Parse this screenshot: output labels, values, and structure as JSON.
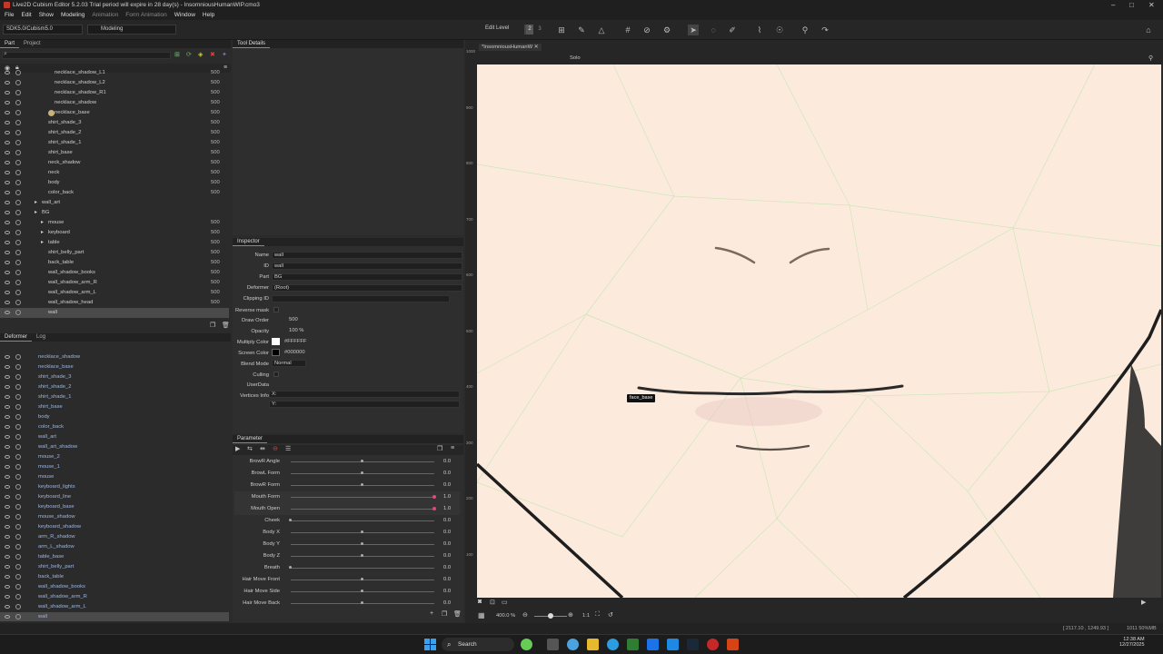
{
  "window": {
    "title": "Live2D Cubism Editor 5.2.03   Trial period will expire in 28 day(s)  - InsomniousHumanWIP.cmo3"
  },
  "menu": [
    "File",
    "Edit",
    "Show",
    "Modeling",
    "Animation",
    "Form Animation",
    "Window",
    "Help"
  ],
  "toolbar": {
    "sdk": "SDK5.0/Cubism5.0",
    "mode": "Modeling",
    "edit_level": "Edit Level",
    "levels": [
      "1",
      "2",
      "3"
    ]
  },
  "part_panel": {
    "tabs": [
      "Part",
      "Project"
    ],
    "items": [
      {
        "name": "necklace_shadow_L1",
        "num": "500",
        "indent": 60
      },
      {
        "name": "necklace_shadow_L2",
        "num": "500",
        "indent": 60
      },
      {
        "name": "necklace_shadow_R1",
        "num": "500",
        "indent": 60
      },
      {
        "name": "necklace_shadow",
        "num": "500",
        "indent": 60
      },
      {
        "name": "necklace_base",
        "num": "500",
        "indent": 60,
        "thumb": true
      },
      {
        "name": "shirt_shade_3",
        "num": "500",
        "indent": 53
      },
      {
        "name": "shirt_shade_2",
        "num": "500",
        "indent": 53
      },
      {
        "name": "shirt_shade_1",
        "num": "500",
        "indent": 53
      },
      {
        "name": "shirt_base",
        "num": "500",
        "indent": 53
      },
      {
        "name": "neck_shadow",
        "num": "500",
        "indent": 53
      },
      {
        "name": "neck",
        "num": "500",
        "indent": 53
      },
      {
        "name": "body",
        "num": "500",
        "indent": 53
      },
      {
        "name": "color_back",
        "num": "500",
        "indent": 53
      },
      {
        "name": "wall_art",
        "num": "",
        "indent": 46,
        "folder": true
      },
      {
        "name": "BG",
        "num": "",
        "indent": 46,
        "folder": true
      },
      {
        "name": "mouse",
        "num": "500",
        "indent": 53,
        "folder": true
      },
      {
        "name": "keyboard",
        "num": "500",
        "indent": 53,
        "folder": true
      },
      {
        "name": "table",
        "num": "500",
        "indent": 53,
        "folder": true
      },
      {
        "name": "shirt_belly_part",
        "num": "500",
        "indent": 53
      },
      {
        "name": "back_table",
        "num": "500",
        "indent": 53
      },
      {
        "name": "wall_shadow_books",
        "num": "500",
        "indent": 53
      },
      {
        "name": "wall_shadow_arm_R",
        "num": "500",
        "indent": 53
      },
      {
        "name": "wall_shadow_arm_L",
        "num": "500",
        "indent": 53
      },
      {
        "name": "wall_shadow_head",
        "num": "500",
        "indent": 53
      },
      {
        "name": "wall",
        "num": "",
        "indent": 53,
        "selected": true
      }
    ]
  },
  "deformer_panel": {
    "tabs": [
      "Deformer",
      "Log"
    ],
    "items": [
      "necklace_shadow",
      "necklace_base",
      "shirt_shade_3",
      "shirt_shade_2",
      "shirt_shade_1",
      "shirt_base",
      "body",
      "color_back",
      "wall_art",
      "wall_art_shadow",
      "mouse_2",
      "mouse_1",
      "mouse",
      "keyboard_lights",
      "keyboard_line",
      "keyboard_base",
      "mouse_shadow",
      "keyboard_shadow",
      "arm_R_shadow",
      "arm_L_shadow",
      "table_base",
      "shirt_belly_part",
      "back_table",
      "wall_shadow_books",
      "wall_shadow_arm_R",
      "wall_shadow_arm_L",
      "wall"
    ]
  },
  "tool_details": {
    "title": "Tool Details"
  },
  "inspector": {
    "title": "Inspector",
    "name_label": "Name",
    "name": "wall",
    "id_label": "ID",
    "id": "wall",
    "part_label": "Part",
    "part": "BG",
    "deformer_label": "Deformer",
    "deformer": "(Root)",
    "clipping_label": "Clipping ID",
    "reverse_label": "Reverse mask",
    "draw_order_label": "Draw Order",
    "draw_order": "500",
    "opacity_label": "Opacity",
    "opacity": "100 %",
    "multiply_label": "Multiply Color",
    "multiply": "#FFFFFF",
    "screen_label": "Screen Color",
    "screen": "#000000",
    "blend_label": "Blend Mode",
    "blend": "Normal",
    "culling_label": "Culling",
    "userdata_label": "UserData",
    "vertices_label": "Vertices Info",
    "vx": "X:",
    "vy": "Y:"
  },
  "parameter": {
    "title": "Parameter",
    "rows": [
      {
        "name": "BrowR Angle",
        "value": "0.0",
        "pos": 0.5
      },
      {
        "name": "BrowL Form",
        "value": "0.0",
        "pos": 0.5
      },
      {
        "name": "BrowR Form",
        "value": "0.0",
        "pos": 0.5
      },
      {
        "name": "Mouth Form",
        "value": "1.0",
        "pos": 1.0,
        "active": true
      },
      {
        "name": "Mouth Open",
        "value": "1.0",
        "pos": 1.0,
        "active": true
      },
      {
        "name": "Cheek",
        "value": "0.0",
        "pos": 0.0
      },
      {
        "name": "Body X",
        "value": "0.0",
        "pos": 0.5
      },
      {
        "name": "Body Y",
        "value": "0.0",
        "pos": 0.5
      },
      {
        "name": "Body Z",
        "value": "0.0",
        "pos": 0.5
      },
      {
        "name": "Breath",
        "value": "0.0",
        "pos": 0.0
      },
      {
        "name": "Hair Move Front",
        "value": "0.0",
        "pos": 0.5
      },
      {
        "name": "Hair Move Side",
        "value": "0.0",
        "pos": 0.5
      },
      {
        "name": "Hair Move Back",
        "value": "0.0",
        "pos": 0.5
      }
    ]
  },
  "viewport": {
    "tab": "*InsomniousHumanW",
    "solo": "Solo",
    "label": "face_base",
    "zoom": "400.0 %",
    "ratio": "1:1",
    "ruler": [
      "1000",
      "900",
      "800",
      "700",
      "600",
      "500",
      "400",
      "300",
      "200",
      "100"
    ]
  },
  "status": {
    "coords": "[ 2117.10 , 1249.93 ]",
    "extra": "1011  50%MB"
  },
  "taskbar": {
    "search": "Search",
    "time": "12:38 AM",
    "date": "12/27/2025"
  }
}
